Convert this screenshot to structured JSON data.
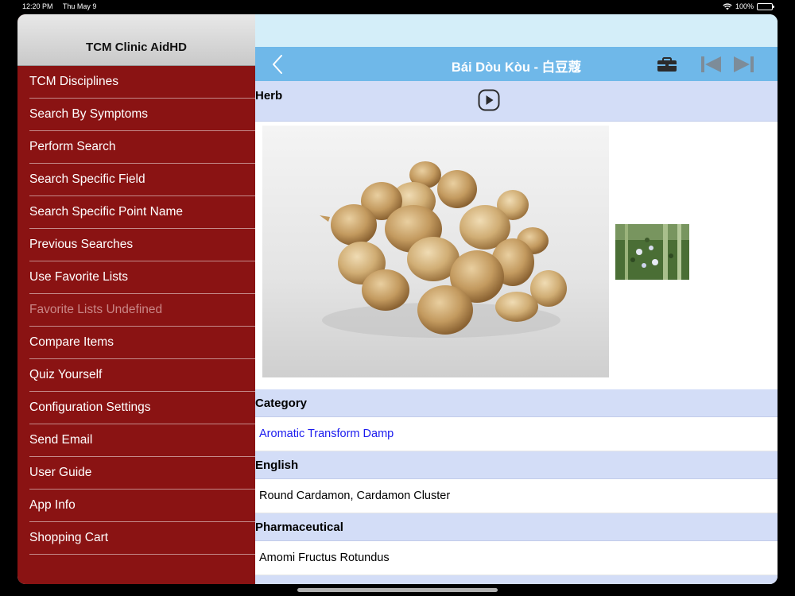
{
  "status": {
    "time": "12:20 PM",
    "date": "Thu May 9",
    "battery": "100%"
  },
  "sidebar": {
    "title": "TCM Clinic AidHD",
    "items": [
      {
        "label": "TCM Disciplines",
        "enabled": true
      },
      {
        "label": "Search By Symptoms",
        "enabled": true
      },
      {
        "label": "Perform Search",
        "enabled": true
      },
      {
        "label": "Search Specific Field",
        "enabled": true
      },
      {
        "label": "Search Specific Point Name",
        "enabled": true
      },
      {
        "label": "Previous Searches",
        "enabled": true
      },
      {
        "label": "Use Favorite Lists",
        "enabled": true
      },
      {
        "label": "Favorite Lists Undefined",
        "enabled": false
      },
      {
        "label": "Compare Items",
        "enabled": true
      },
      {
        "label": "Quiz Yourself",
        "enabled": true
      },
      {
        "label": "Configuration Settings",
        "enabled": true
      },
      {
        "label": "Send Email",
        "enabled": true
      },
      {
        "label": "User Guide",
        "enabled": true
      },
      {
        "label": "App Info",
        "enabled": true
      },
      {
        "label": "Shopping Cart",
        "enabled": true
      }
    ]
  },
  "navbar": {
    "title": "Bái Dòu Kòu - 白豆蔻",
    "icons": [
      "chevron-left-icon",
      "toolbox-icon",
      "skip-first-icon",
      "skip-last-icon"
    ]
  },
  "herb": {
    "label": "Herb",
    "play_icon": "play-circle-icon"
  },
  "sections": {
    "category": {
      "label": "Category",
      "value": "Aromatic Transform Damp"
    },
    "english": {
      "label": "English",
      "value": "Round Cardamon, Cardamon Cluster"
    },
    "pharmaceutical": {
      "label": "Pharmaceutical",
      "value": "Amomi Fructus Rotundus"
    }
  },
  "colors": {
    "sidebar_bg": "#8a1313",
    "navbar_bg": "#6fb8e9",
    "section_header_bg": "#d3ddf7",
    "link": "#1a1aee"
  }
}
